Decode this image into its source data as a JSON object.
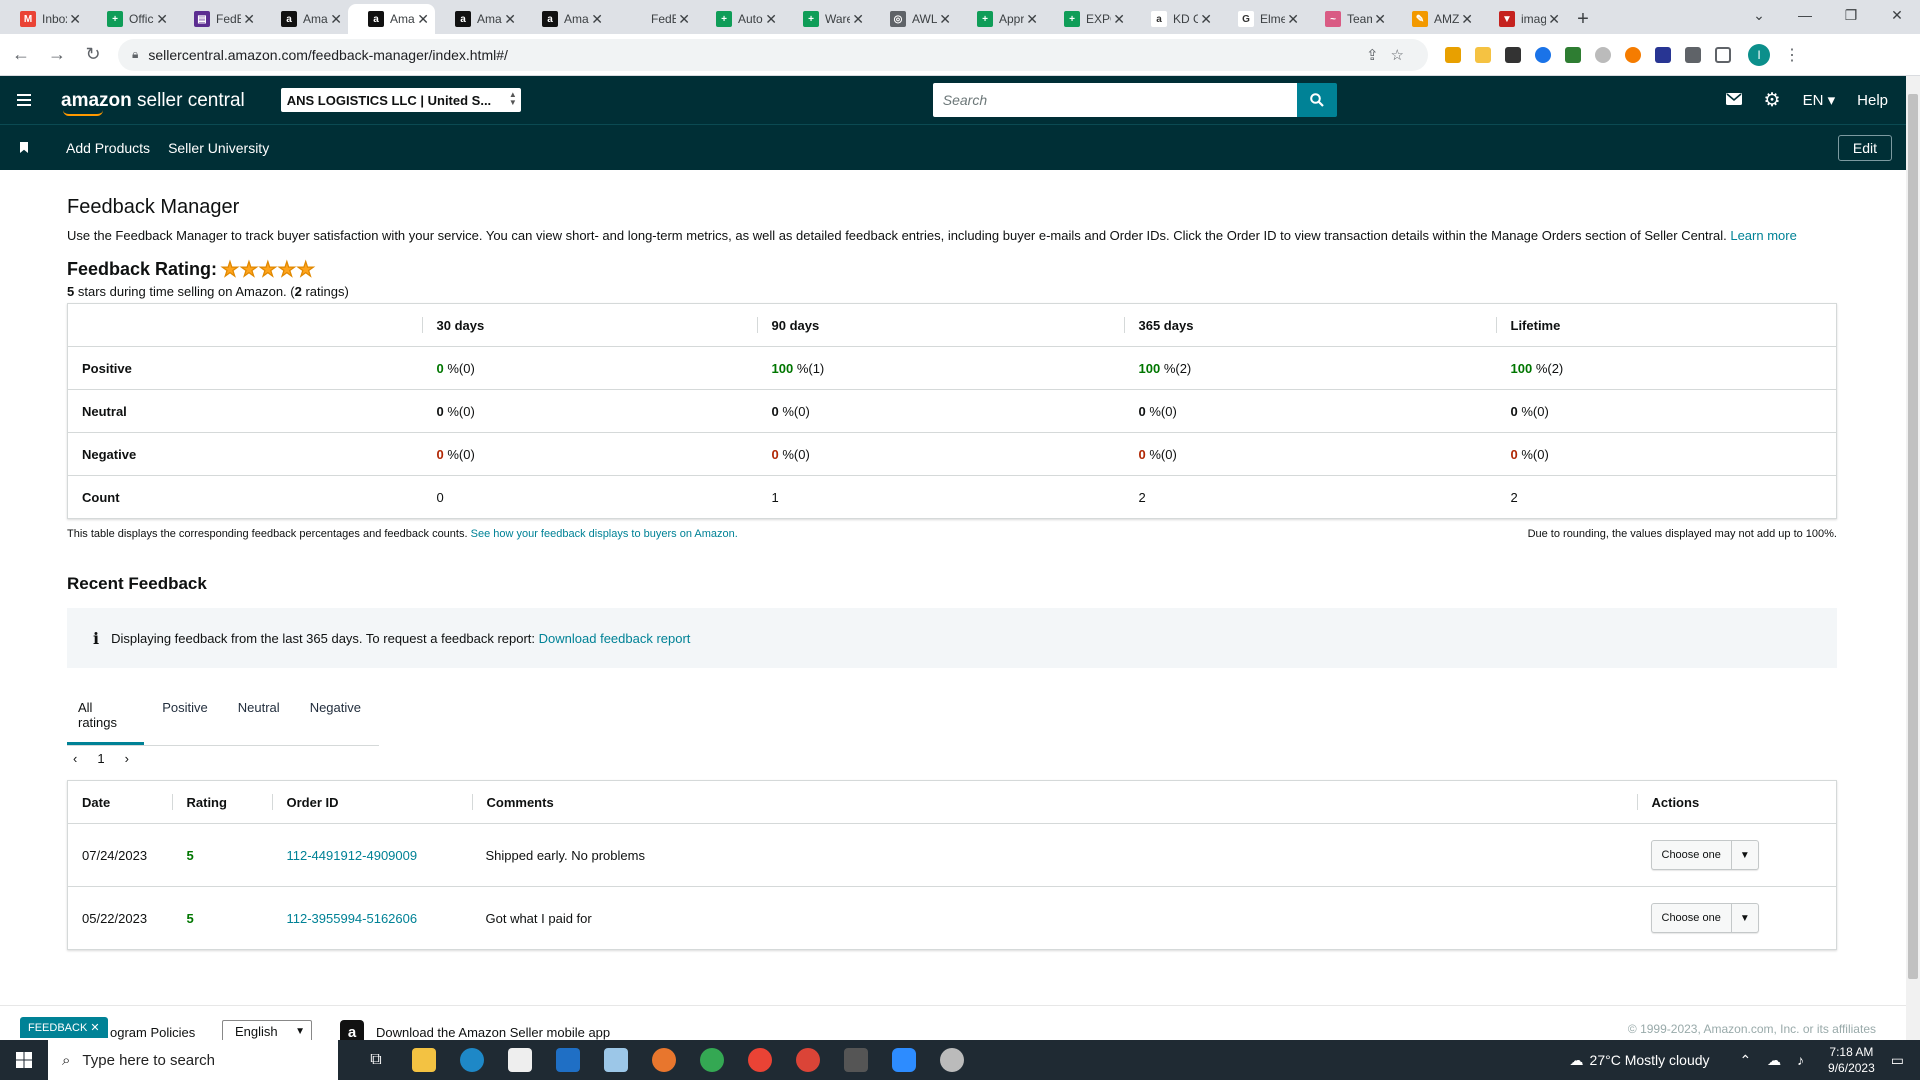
{
  "browser": {
    "tabs": [
      {
        "label": "Inbox",
        "color": "#ea4335",
        "glyph": "M"
      },
      {
        "label": "Offici",
        "color": "#0f9d58",
        "glyph": "+"
      },
      {
        "label": "FedEx",
        "color": "#5c2d91",
        "glyph": "▤"
      },
      {
        "label": "Amaz",
        "color": "#111111",
        "glyph": "a"
      },
      {
        "label": "Amaz",
        "color": "#111111",
        "glyph": "a",
        "active": true
      },
      {
        "label": "Amaz",
        "color": "#111111",
        "glyph": "a"
      },
      {
        "label": "Amaz",
        "color": "#111111",
        "glyph": "a"
      },
      {
        "label": "FedE",
        "color": "#dee1e6",
        "glyph": ""
      },
      {
        "label": "Auto",
        "color": "#0f9d58",
        "glyph": "+"
      },
      {
        "label": "Ware",
        "color": "#0f9d58",
        "glyph": "+"
      },
      {
        "label": "AWL",
        "color": "#5f6368",
        "glyph": "◎"
      },
      {
        "label": "Appr",
        "color": "#0f9d58",
        "glyph": "+"
      },
      {
        "label": "EXPO",
        "color": "#0f9d58",
        "glyph": "+"
      },
      {
        "label": "KD G",
        "color": "#ffffff",
        "glyph": "a"
      },
      {
        "label": "Elme",
        "color": "#ffffff",
        "glyph": "G"
      },
      {
        "label": "Team",
        "color": "#d95b84",
        "glyph": "~"
      },
      {
        "label": "AMZ",
        "color": "#f29900",
        "glyph": "✎"
      },
      {
        "label": "imag",
        "color": "#c5221f",
        "glyph": "▼"
      }
    ],
    "url": "sellercentral.amazon.com/feedback-manager/index.html#/"
  },
  "header": {
    "logo_main": "amazon",
    "logo_sub": "seller central",
    "account": "ANS LOGISTICS LLC | United S...",
    "search_placeholder": "Search",
    "lang": "EN",
    "help": "Help",
    "nav": [
      "Add Products",
      "Seller University"
    ],
    "edit": "Edit"
  },
  "main": {
    "title": "Feedback Manager",
    "description": "Use the Feedback Manager to track buyer satisfaction with your service. You can view short- and long-term metrics, as well as detailed feedback entries, including buyer e-mails and Order IDs. Click the Order ID to view transaction details within the Manage Orders section of Seller Central.",
    "learn_more": "Learn more",
    "rating_label": "Feedback Rating:",
    "rating_stars": "★★★★★",
    "rating_value": "5",
    "rating_sub_mid": " stars during time selling on Amazon. (",
    "rating_count": "2",
    "rating_sub_end": " ratings)",
    "metrics": {
      "columns": [
        "30 days",
        "90 days",
        "365 days",
        "Lifetime"
      ],
      "rows": [
        {
          "label": "Positive",
          "cells": [
            [
              "0",
              " %(0)"
            ],
            [
              "100",
              " %(1)"
            ],
            [
              "100",
              " %(2)"
            ],
            [
              "100",
              " %(2)"
            ]
          ]
        },
        {
          "label": "Neutral",
          "cells": [
            [
              "0",
              " %(0)"
            ],
            [
              "0",
              " %(0)"
            ],
            [
              "0",
              " %(0)"
            ],
            [
              "0",
              " %(0)"
            ]
          ]
        },
        {
          "label": "Negative",
          "cells": [
            [
              "0",
              " %(0)"
            ],
            [
              "0",
              " %(0)"
            ],
            [
              "0",
              " %(0)"
            ],
            [
              "0",
              " %(0)"
            ]
          ]
        },
        {
          "label": "Count",
          "cells": [
            [
              "0",
              ""
            ],
            [
              "1",
              ""
            ],
            [
              "2",
              ""
            ],
            [
              "2",
              ""
            ]
          ]
        }
      ]
    },
    "table_note": "This table displays the corresponding feedback percentages and feedback counts.",
    "table_note_link": "See how your feedback displays to buyers on Amazon.",
    "rounding_note": "Due to rounding, the values displayed may not add up to 100%.",
    "recent_title": "Recent Feedback",
    "info_text": "Displaying feedback from the last 365 days. To request a feedback report:",
    "info_link": "Download feedback report",
    "filter_tabs": [
      "All ratings",
      "Positive",
      "Neutral",
      "Negative"
    ],
    "page": "1",
    "feedback_columns": [
      "Date",
      "Rating",
      "Order ID",
      "Comments",
      "Actions"
    ],
    "feedback_rows": [
      {
        "date": "07/24/2023",
        "rating": "5",
        "order": "112-4491912-4909009",
        "comment": "Shipped early. No problems",
        "action": "Choose one"
      },
      {
        "date": "05/22/2023",
        "rating": "5",
        "order": "112-3955994-5162606",
        "comment": "Got what I paid for",
        "action": "Choose one"
      }
    ]
  },
  "footer": {
    "feedback_btn": "FEEDBACK",
    "policies": "ogram Policies",
    "language": "English",
    "app": "Download the Amazon Seller mobile app",
    "copyright": "© 1999-2023, Amazon.com, Inc. or its affiliates"
  },
  "taskbar": {
    "search_placeholder": "Type here to search",
    "weather": "27°C  Mostly cloudy",
    "time": "7:18 AM",
    "date": "9/6/2023"
  }
}
